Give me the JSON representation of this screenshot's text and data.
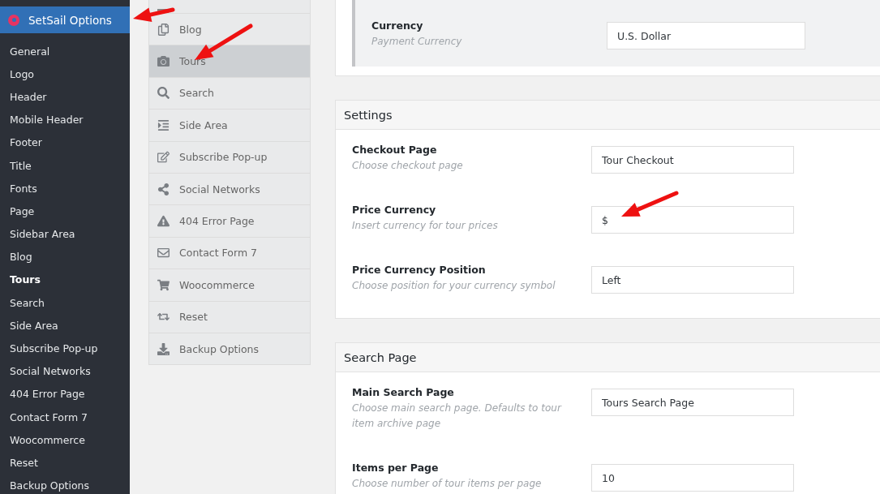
{
  "admin_menu": {
    "title": "SetSail Options",
    "items": [
      {
        "label": "General",
        "selected": false
      },
      {
        "label": "Logo",
        "selected": false
      },
      {
        "label": "Header",
        "selected": false
      },
      {
        "label": "Mobile Header",
        "selected": false
      },
      {
        "label": "Footer",
        "selected": false
      },
      {
        "label": "Title",
        "selected": false
      },
      {
        "label": "Fonts",
        "selected": false
      },
      {
        "label": "Page",
        "selected": false
      },
      {
        "label": "Sidebar Area",
        "selected": false
      },
      {
        "label": "Blog",
        "selected": false
      },
      {
        "label": "Tours",
        "selected": true
      },
      {
        "label": "Search",
        "selected": false
      },
      {
        "label": "Side Area",
        "selected": false
      },
      {
        "label": "Subscribe Pop-up",
        "selected": false
      },
      {
        "label": "Social Networks",
        "selected": false
      },
      {
        "label": "404 Error Page",
        "selected": false
      },
      {
        "label": "Contact Form 7",
        "selected": false
      },
      {
        "label": "Woocommerce",
        "selected": false
      },
      {
        "label": "Reset",
        "selected": false
      },
      {
        "label": "Backup Options",
        "selected": false
      }
    ]
  },
  "tabs": [
    {
      "label": "Blog",
      "selected": false
    },
    {
      "label": "Tours",
      "selected": true
    },
    {
      "label": "Search",
      "selected": false
    },
    {
      "label": "Side Area",
      "selected": false
    },
    {
      "label": "Subscribe Pop-up",
      "selected": false
    },
    {
      "label": "Social Networks",
      "selected": false
    },
    {
      "label": "404 Error Page",
      "selected": false
    },
    {
      "label": "Contact Form 7",
      "selected": false
    },
    {
      "label": "Woocommerce",
      "selected": false
    },
    {
      "label": "Reset",
      "selected": false
    },
    {
      "label": "Backup Options",
      "selected": false
    }
  ],
  "top_panel": {
    "fields": [
      {
        "label": "Currency",
        "description": "Payment Currency",
        "value": "U.S. Dollar"
      }
    ]
  },
  "sections": [
    {
      "title": "Settings",
      "fields": [
        {
          "label": "Checkout Page",
          "description": "Choose checkout page",
          "value": "Tour Checkout"
        },
        {
          "label": "Price Currency",
          "description": "Insert currency for tour prices",
          "value": "$"
        },
        {
          "label": "Price Currency Position",
          "description": "Choose position for your currency symbol",
          "value": "Left"
        }
      ]
    },
    {
      "title": "Search Page",
      "fields": [
        {
          "label": "Main Search Page",
          "description": "Choose main search page. Defaults to tour item archive page",
          "value": "Tours Search Page"
        },
        {
          "label": "Items per Page",
          "description": "Choose number of tour items per page",
          "value": "10"
        }
      ]
    }
  ]
}
